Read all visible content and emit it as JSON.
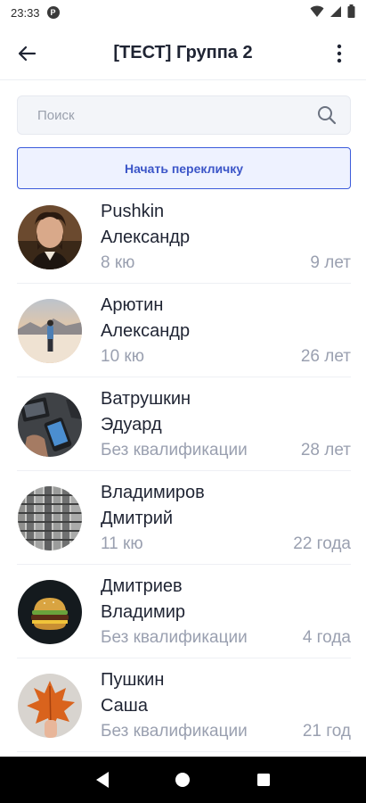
{
  "status_bar": {
    "time": "23:33",
    "app_badge": "P"
  },
  "header": {
    "title": "[ТЕСТ] Группа 2"
  },
  "search": {
    "placeholder": "Поиск"
  },
  "rollcall": {
    "label": "Начать перекличку"
  },
  "students": [
    {
      "last_name": "Pushkin",
      "first_name": "Александр",
      "qualification": "8 кю",
      "age": "9 лет"
    },
    {
      "last_name": "Арютин",
      "first_name": "Александр",
      "qualification": "10 кю",
      "age": "26 лет"
    },
    {
      "last_name": "Ватрушкин",
      "first_name": "Эдуард",
      "qualification": "Без квалификации",
      "age": "28 лет"
    },
    {
      "last_name": "Владимиров",
      "first_name": "Дмитрий",
      "qualification": "11 кю",
      "age": "22 года"
    },
    {
      "last_name": "Дмитриев",
      "first_name": "Владимир",
      "qualification": "Без квалификации",
      "age": "4 года"
    },
    {
      "last_name": "Пушкин",
      "first_name": "Саша",
      "qualification": "Без квалификации",
      "age": "21 год"
    }
  ],
  "colors": {
    "accent": "#3b55c8",
    "accent_bg": "#eef2ff",
    "muted_text": "#9aa0b0"
  },
  "icons": {
    "back": "arrow-left-icon",
    "more": "more-vertical-icon",
    "search": "search-icon"
  }
}
